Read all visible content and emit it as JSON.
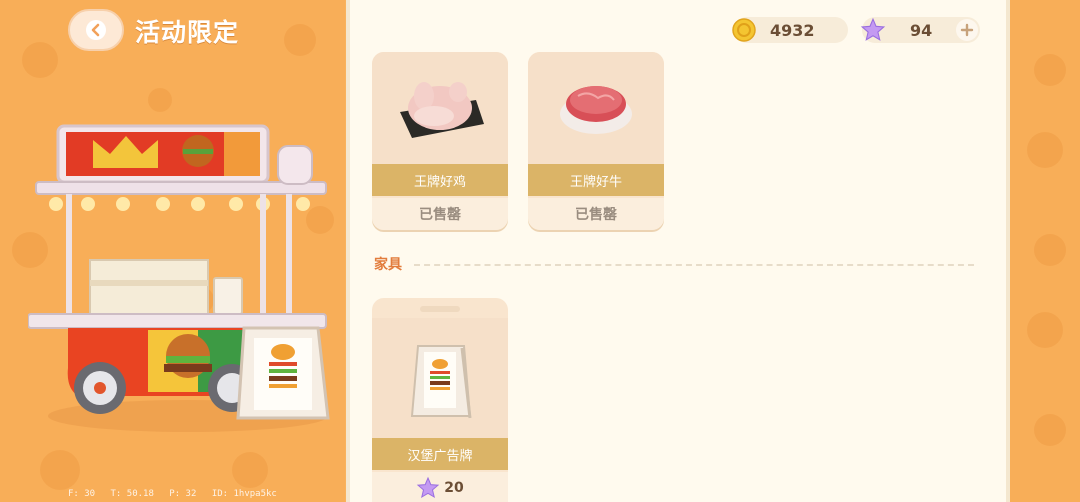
{
  "header": {
    "title": "活动限定"
  },
  "currencies": {
    "coins": "4932",
    "stars": "94"
  },
  "items": [
    {
      "name": "王牌好鸡",
      "status": "已售罄"
    },
    {
      "name": "王牌好牛",
      "status": "已售罄"
    }
  ],
  "furniture_section": {
    "label": "家具",
    "items": [
      {
        "name": "汉堡广告牌",
        "price": "20"
      }
    ]
  },
  "debug": {
    "f": "F: 30",
    "t": "T: 50.18",
    "p": "P: 32",
    "id": "ID: 1hvpa5kc"
  },
  "colors": {
    "background": "#f8ae58",
    "panel": "#fffaee",
    "name_bar": "#dbb467",
    "section_label": "#e27c3c"
  },
  "icons": [
    "back-arrow-icon",
    "coin-icon",
    "star-icon",
    "plus-icon"
  ]
}
